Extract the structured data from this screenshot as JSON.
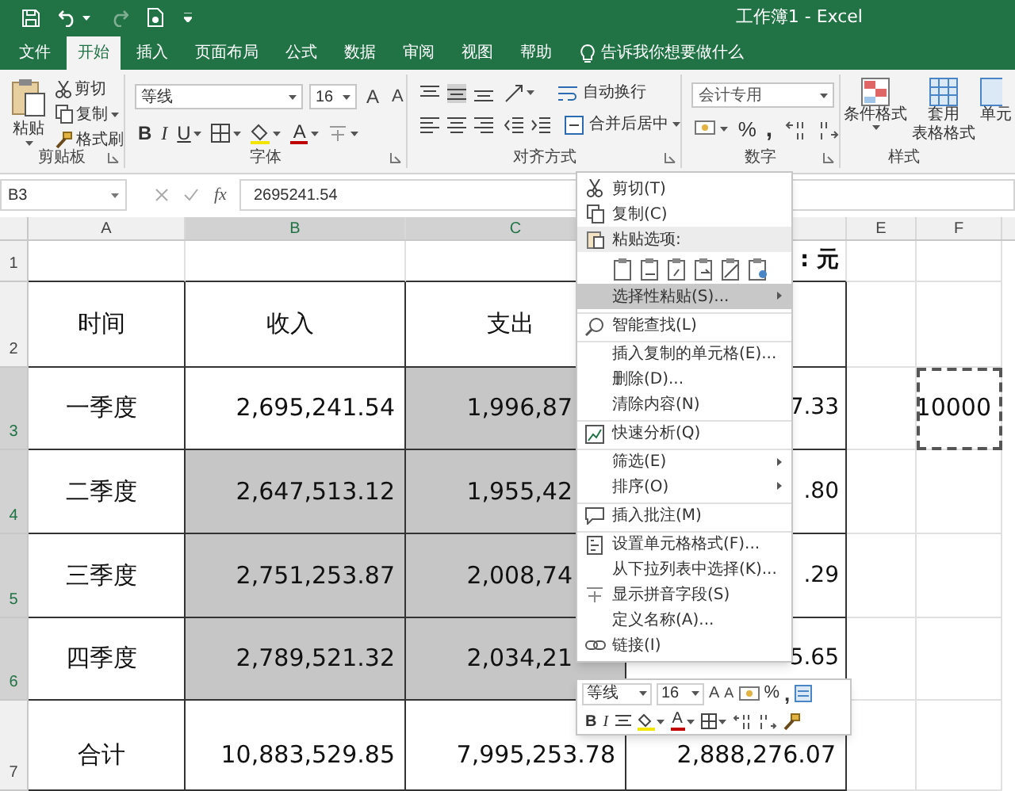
{
  "title_bar": {
    "title": "工作簿1 - Excel"
  },
  "tabs": [
    {
      "label": "文件",
      "selected": false
    },
    {
      "label": "开始",
      "selected": true
    },
    {
      "label": "插入",
      "selected": false
    },
    {
      "label": "页面布局",
      "selected": false
    },
    {
      "label": "公式",
      "selected": false
    },
    {
      "label": "数据",
      "selected": false
    },
    {
      "label": "审阅",
      "selected": false
    },
    {
      "label": "视图",
      "selected": false
    },
    {
      "label": "帮助",
      "selected": false
    }
  ],
  "tell_me": "告诉我你想要做什么",
  "ribbon": {
    "clipboard": {
      "label": "剪贴板",
      "paste": "粘贴",
      "cut": "剪切",
      "copy": "复制",
      "format_painter": "格式刷"
    },
    "font": {
      "label": "字体",
      "font_name": "等线",
      "font_size": "16",
      "grow_font": "A",
      "shrink_font": "A",
      "bold": "B",
      "italic": "I",
      "underline": "U",
      "font_color": "A"
    },
    "alignment": {
      "label": "对齐方式",
      "wrap_text": "自动换行",
      "merge_center": "合并后居中"
    },
    "number": {
      "label": "数字",
      "format": "会计专用",
      "percent": "%",
      "comma": ","
    },
    "styles": {
      "label": "样式",
      "conditional_format": "条件格式",
      "format_as_table": [
        "套用",
        "表格格式"
      ],
      "cell_styles": "单元"
    }
  },
  "formula_bar": {
    "name_box": "B3",
    "function_label": "fx",
    "formula": "2695241.54"
  },
  "columns": [
    {
      "label": "A",
      "selected": false
    },
    {
      "label": "B",
      "selected": true
    },
    {
      "label": "C",
      "selected": true
    },
    {
      "selected": false
    },
    {
      "label": "E",
      "selected": false
    },
    {
      "label": "F",
      "selected": false
    }
  ],
  "rows": [
    {
      "header": "1",
      "selected": false,
      "cells": [
        {
          "selected": false
        },
        {
          "selected": false
        },
        {
          "selected": false
        },
        {
          "text": ": 元",
          "selected": false
        },
        {
          "selected": false
        },
        {
          "selected": false
        }
      ]
    },
    {
      "header": "2",
      "selected": false,
      "cells": [
        {
          "text": "时间",
          "selected": false
        },
        {
          "text": "收入",
          "selected": false
        },
        {
          "text": "支出",
          "selected": false
        },
        {
          "selected": false
        },
        {
          "selected": false
        },
        {
          "selected": false
        }
      ]
    },
    {
      "header": "3",
      "selected": true,
      "cells": [
        {
          "text": "一季度",
          "selected": false
        },
        {
          "text": "2,695,241.54",
          "selected": false
        },
        {
          "text": "1,996,87",
          "selected": true
        },
        {
          "text": "7.33",
          "selected": false
        },
        {
          "selected": false
        },
        {
          "text": "10000",
          "selected": false,
          "copied": true
        }
      ]
    },
    {
      "header": "4",
      "selected": true,
      "cells": [
        {
          "text": "二季度",
          "selected": false
        },
        {
          "text": "2,647,513.12",
          "selected": true
        },
        {
          "text": "1,955,42",
          "selected": true
        },
        {
          "text": ".80",
          "selected": false
        },
        {
          "selected": false
        },
        {
          "selected": false
        }
      ]
    },
    {
      "header": "5",
      "selected": true,
      "cells": [
        {
          "text": "三季度",
          "selected": false
        },
        {
          "text": "2,751,253.87",
          "selected": true
        },
        {
          "text": "2,008,74",
          "selected": true
        },
        {
          "text": ".29",
          "selected": false
        },
        {
          "selected": false
        },
        {
          "selected": false
        }
      ]
    },
    {
      "header": "6",
      "selected": true,
      "cells": [
        {
          "text": "四季度",
          "selected": false
        },
        {
          "text": "2,789,521.32",
          "selected": true
        },
        {
          "text": "2,034,21",
          "selected": true
        },
        {
          "text": "5.65",
          "selected": false
        },
        {
          "selected": false
        },
        {
          "selected": false
        }
      ]
    },
    {
      "header": "7",
      "selected": false,
      "cells": [
        {
          "text": "合计",
          "selected": false
        },
        {
          "text": "10,883,529.85",
          "selected": false
        },
        {
          "text": "7,995,253.78",
          "selected": false
        },
        {
          "text": "2,888,276.07",
          "selected": false
        },
        {
          "selected": false
        },
        {
          "selected": false
        }
      ]
    }
  ],
  "context_menu": {
    "items": [
      {
        "kind": "item",
        "label": "剪切(T)",
        "highlighted": false,
        "submenu": false,
        "separator_before": false
      },
      {
        "kind": "item",
        "label": "复制(C)",
        "highlighted": false,
        "submenu": false,
        "separator_before": false
      },
      {
        "kind": "header",
        "label": "粘贴选项:",
        "highlighted": false,
        "submenu": false,
        "separator_before": false
      },
      {
        "kind": "paste_options",
        "highlighted": false,
        "submenu": false,
        "separator_before": false
      },
      {
        "kind": "item",
        "label": "选择性粘贴(S)...",
        "highlighted": true,
        "submenu": true,
        "separator_before": false
      },
      {
        "kind": "item",
        "label": "智能查找(L)",
        "highlighted": false,
        "submenu": false,
        "separator_before": true
      },
      {
        "kind": "item",
        "label": "插入复制的单元格(E)...",
        "highlighted": false,
        "submenu": false,
        "separator_before": true
      },
      {
        "kind": "item",
        "label": "删除(D)...",
        "highlighted": false,
        "submenu": false,
        "separator_before": false
      },
      {
        "kind": "item",
        "label": "清除内容(N)",
        "highlighted": false,
        "submenu": false,
        "separator_before": false
      },
      {
        "kind": "item",
        "label": "快速分析(Q)",
        "highlighted": false,
        "submenu": false,
        "separator_before": true
      },
      {
        "kind": "item",
        "label": "筛选(E)",
        "highlighted": false,
        "submenu": true,
        "separator_before": true
      },
      {
        "kind": "item",
        "label": "排序(O)",
        "highlighted": false,
        "submenu": true,
        "separator_before": false
      },
      {
        "kind": "item",
        "label": "插入批注(M)",
        "highlighted": false,
        "submenu": false,
        "separator_before": true
      },
      {
        "kind": "item",
        "label": "设置单元格格式(F)...",
        "highlighted": false,
        "submenu": false,
        "separator_before": true
      },
      {
        "kind": "item",
        "label": "从下拉列表中选择(K)...",
        "highlighted": false,
        "submenu": false,
        "separator_before": false
      },
      {
        "kind": "item",
        "label": "显示拼音字段(S)",
        "highlighted": false,
        "submenu": false,
        "separator_before": false
      },
      {
        "kind": "item",
        "label": "定义名称(A)...",
        "highlighted": false,
        "submenu": false,
        "separator_before": false
      },
      {
        "kind": "item",
        "label": "链接(I)",
        "highlighted": false,
        "submenu": false,
        "separator_before": false
      }
    ]
  },
  "mini_toolbar": {
    "font_name": "等线",
    "font_size": "16",
    "grow_font": "A",
    "shrink_font": "A",
    "percent": "%",
    "comma": ",",
    "bold": "B",
    "italic": "I",
    "font_color": "A"
  }
}
